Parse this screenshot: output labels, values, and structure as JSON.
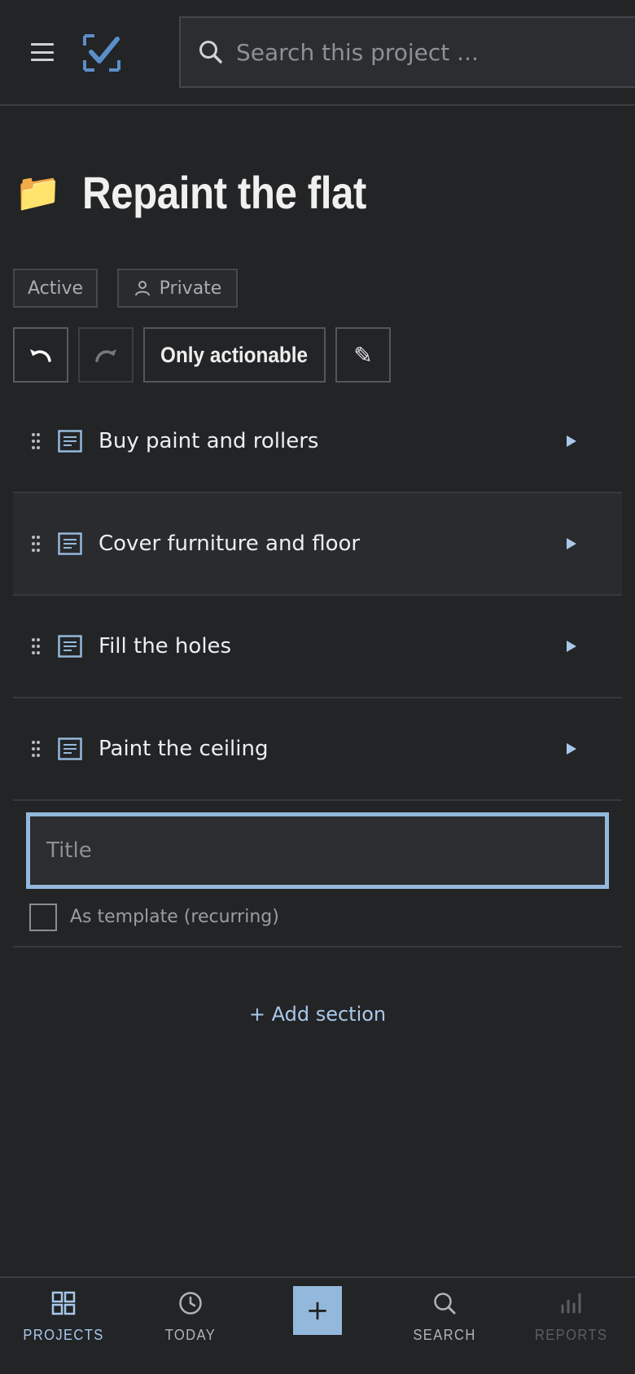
{
  "header": {
    "search_placeholder": "Search this project ..."
  },
  "project": {
    "title": "Repaint the flat",
    "folder_icon": "📁",
    "status_tag": "Active",
    "visibility_tag": "Private"
  },
  "toolbar": {
    "undo_icon": "undo-icon",
    "redo_icon": "redo-icon",
    "actionable_label": "Only actionable",
    "edit_icon": "✎"
  },
  "tasks": [
    {
      "label": "Buy paint and rollers"
    },
    {
      "label": "Cover furniture and floor"
    },
    {
      "label": "Fill the holes"
    },
    {
      "label": "Paint the ceiling"
    }
  ],
  "new_task": {
    "title_placeholder": "Title",
    "template_label": "As template (recurring)"
  },
  "add_section_label": "+ Add section",
  "bottom_nav": {
    "projects": "PROJECTS",
    "today": "TODAY",
    "add": "+",
    "search": "SEARCH",
    "reports": "REPORTS"
  },
  "colors": {
    "background": "#232426",
    "accent": "#94b8dc",
    "accent_text": "#a8c8ea",
    "logo": "#5b8fc9"
  }
}
